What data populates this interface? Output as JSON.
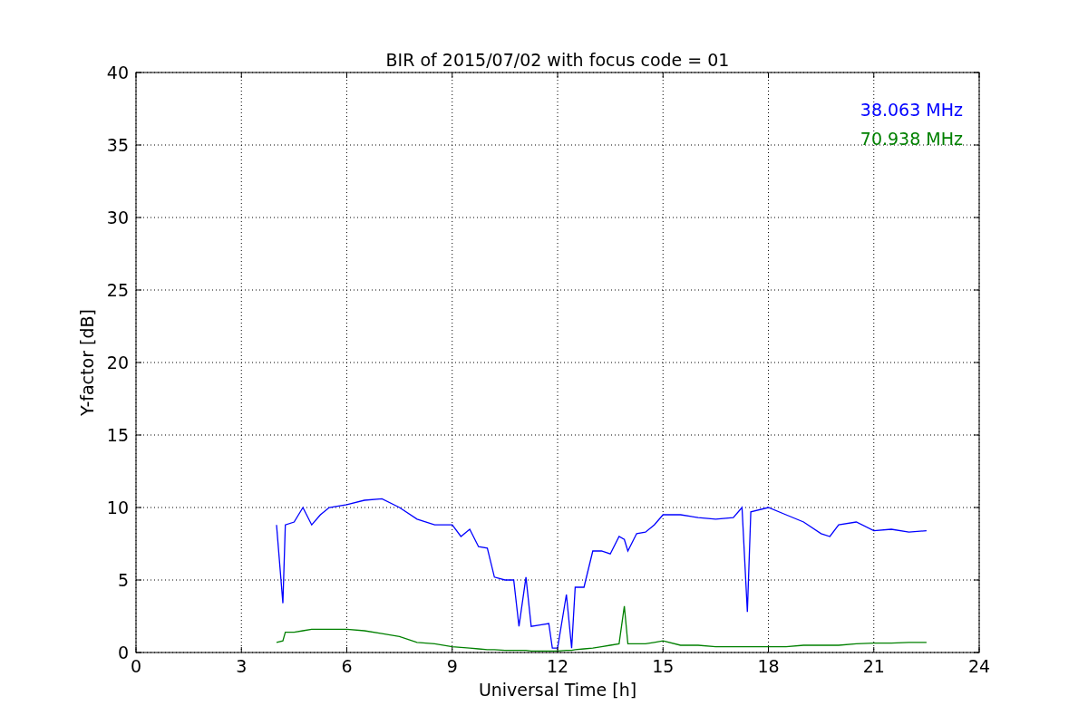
{
  "figure": {
    "chart_data": {
      "type": "line",
      "title": "BIR of 2015/07/02 with focus code = 01",
      "xlabel": "Universal Time [h]",
      "ylabel": "Y-factor [dB]",
      "grid": true,
      "xlim": [
        0,
        24
      ],
      "ylim": [
        0,
        40
      ],
      "xticks": [
        0,
        3,
        6,
        9,
        12,
        15,
        18,
        21,
        24
      ],
      "yticks": [
        0,
        5,
        10,
        15,
        20,
        25,
        30,
        35,
        40
      ],
      "x": [
        4.0,
        4.18,
        4.25,
        4.5,
        4.75,
        5.0,
        5.25,
        5.5,
        6.0,
        6.5,
        7.0,
        7.5,
        8.0,
        8.5,
        9.0,
        9.25,
        9.5,
        9.75,
        10.0,
        10.2,
        10.5,
        10.75,
        10.9,
        11.1,
        11.25,
        11.5,
        11.75,
        11.85,
        12.0,
        12.25,
        12.4,
        12.5,
        12.75,
        13.0,
        13.25,
        13.5,
        13.75,
        13.9,
        14.0,
        14.25,
        14.5,
        14.75,
        15.0,
        15.5,
        16.0,
        16.5,
        17.0,
        17.25,
        17.4,
        17.5,
        18.0,
        18.5,
        19.0,
        19.5,
        19.75,
        20.0,
        20.5,
        21.0,
        21.5,
        22.0,
        22.5
      ],
      "series": [
        {
          "name": "38.063 MHz",
          "color": "#0000ff",
          "values": [
            8.8,
            3.4,
            8.8,
            9.0,
            10.0,
            8.8,
            9.5,
            10.0,
            10.2,
            10.5,
            10.6,
            10.0,
            9.2,
            8.8,
            8.8,
            8.0,
            8.5,
            7.3,
            7.2,
            5.2,
            5.0,
            5.0,
            1.8,
            5.2,
            1.8,
            1.9,
            2.0,
            0.3,
            0.3,
            4.0,
            0.3,
            4.5,
            4.5,
            7.0,
            7.0,
            6.8,
            8.0,
            7.8,
            7.0,
            8.2,
            8.3,
            8.8,
            9.5,
            9.5,
            9.3,
            9.2,
            9.3,
            10.0,
            2.8,
            9.7,
            10.0,
            9.5,
            9.0,
            8.2,
            8.0,
            8.8,
            9.0,
            8.4,
            8.5,
            8.3,
            8.4
          ]
        },
        {
          "name": "70.938 MHz",
          "color": "#008000",
          "values": [
            0.7,
            0.8,
            1.4,
            1.4,
            1.5,
            1.6,
            1.6,
            1.6,
            1.6,
            1.5,
            1.3,
            1.1,
            0.7,
            0.6,
            0.4,
            0.35,
            0.3,
            0.25,
            0.2,
            0.2,
            0.15,
            0.15,
            0.15,
            0.15,
            0.1,
            0.1,
            0.1,
            0.1,
            0.1,
            0.15,
            0.15,
            0.2,
            0.25,
            0.3,
            0.4,
            0.5,
            0.6,
            3.2,
            0.6,
            0.6,
            0.6,
            0.7,
            0.8,
            0.5,
            0.5,
            0.4,
            0.4,
            0.4,
            0.4,
            0.4,
            0.4,
            0.4,
            0.5,
            0.5,
            0.5,
            0.5,
            0.6,
            0.65,
            0.65,
            0.7,
            0.7
          ]
        }
      ]
    }
  }
}
